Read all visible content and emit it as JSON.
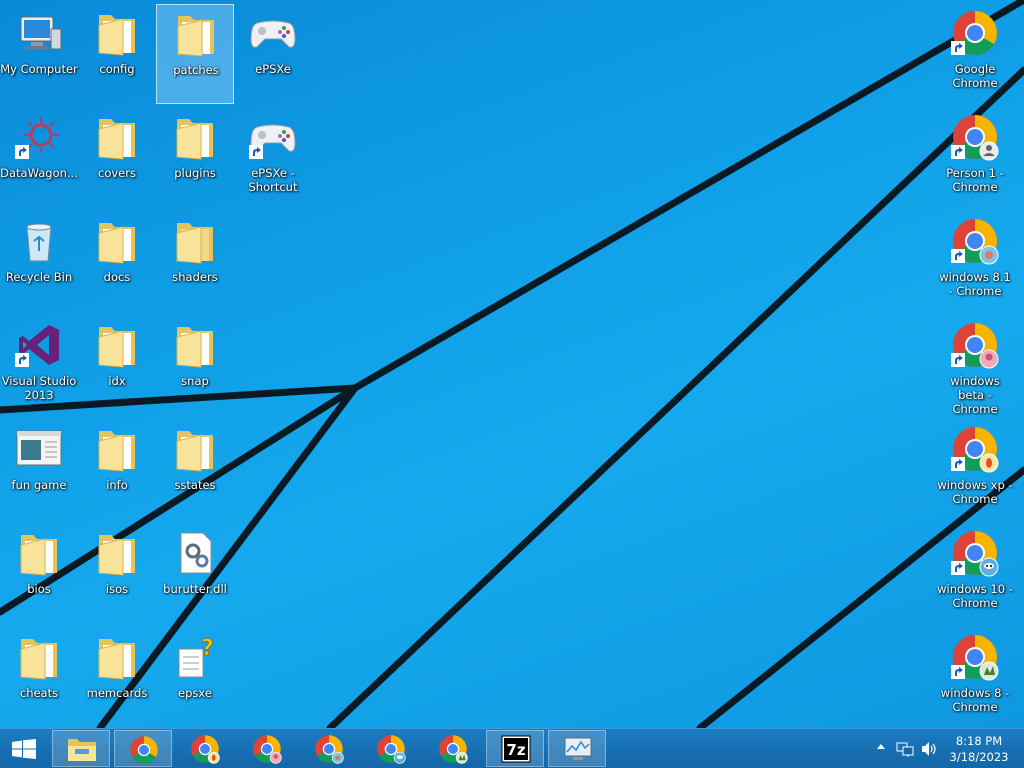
{
  "desktop": {
    "icons": [
      {
        "label": "My Computer",
        "type": "computer"
      },
      {
        "label": "config",
        "type": "folder"
      },
      {
        "label": "patches",
        "type": "folder"
      },
      {
        "label": "ePSXe",
        "type": "gamepad"
      },
      {
        "label": "DataWagon...",
        "type": "sun"
      },
      {
        "label": "covers",
        "type": "folder"
      },
      {
        "label": "plugins",
        "type": "folder"
      },
      {
        "label": "ePSXe - Shortcut",
        "type": "gamepad"
      },
      {
        "label": "Recycle Bin",
        "type": "bin"
      },
      {
        "label": "docs",
        "type": "folder"
      },
      {
        "label": "shaders",
        "type": "folder"
      },
      {
        "label": "Visual Studio 2013",
        "type": "vs"
      },
      {
        "label": "idx",
        "type": "folder"
      },
      {
        "label": "snap",
        "type": "folder"
      },
      {
        "label": "fun game",
        "type": "app"
      },
      {
        "label": "info",
        "type": "folder"
      },
      {
        "label": "sstates",
        "type": "folder"
      },
      {
        "label": "bios",
        "type": "folder"
      },
      {
        "label": "isos",
        "type": "folder"
      },
      {
        "label": "burutter.dll",
        "type": "dll"
      },
      {
        "label": "cheats",
        "type": "folder"
      },
      {
        "label": "memcards",
        "type": "folder"
      },
      {
        "label": "epsxe",
        "type": "unknown"
      },
      {
        "label": "Google Chrome",
        "type": "chrome"
      },
      {
        "label": "Person 1 - Chrome",
        "type": "chrome"
      },
      {
        "label": "windows 8.1 - Chrome",
        "type": "chrome"
      },
      {
        "label": "windows beta - Chrome",
        "type": "chrome"
      },
      {
        "label": "windows xp - Chrome",
        "type": "chrome"
      },
      {
        "label": "windows 10 - Chrome",
        "type": "chrome"
      },
      {
        "label": "windows 8 - Chrome",
        "type": "chrome"
      }
    ]
  },
  "taskbar": {
    "start_icon": "windows-logo-icon",
    "items": [
      {
        "name": "file-explorer",
        "icon": "folder-icon"
      },
      {
        "name": "chrome",
        "icon": "chrome-icon"
      },
      {
        "name": "chrome-windows-xp",
        "icon": "chrome-icon"
      },
      {
        "name": "chrome-windows-beta",
        "icon": "chrome-icon"
      },
      {
        "name": "chrome-windows-81",
        "icon": "chrome-icon"
      },
      {
        "name": "chrome-windows-10",
        "icon": "chrome-icon"
      },
      {
        "name": "chrome-windows-8",
        "icon": "chrome-icon"
      },
      {
        "name": "7zip",
        "icon": "7z-icon"
      },
      {
        "name": "performance-monitor",
        "icon": "monitor-icon"
      }
    ],
    "clock": {
      "time": "8:18 PM",
      "date": "3/18/2023"
    }
  },
  "colors": {
    "wallpaper": "#0f9ee6",
    "taskbar": "#1466a6",
    "chrome_red": "#db4437",
    "chrome_green": "#0f9d58",
    "chrome_yellow": "#f4b400",
    "chrome_blue": "#4285f4"
  }
}
